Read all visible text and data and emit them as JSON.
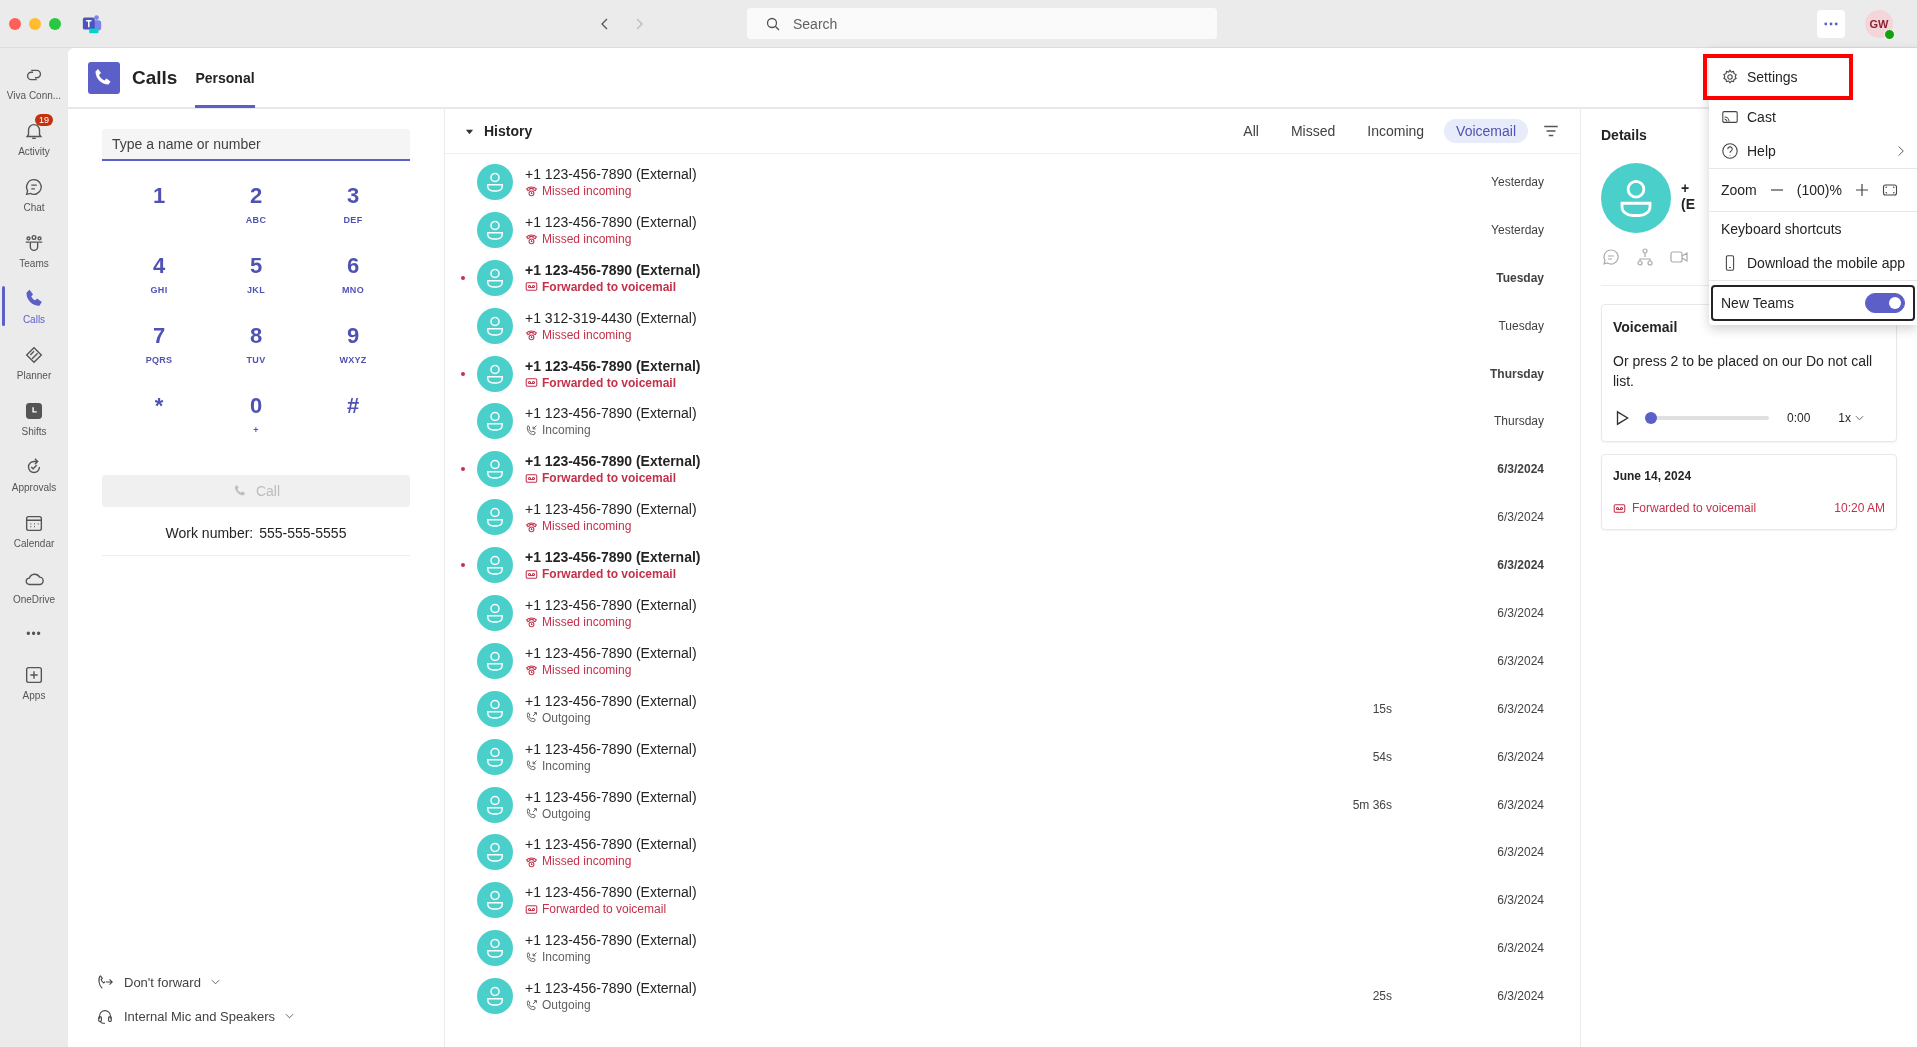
{
  "titlebar": {
    "search": {
      "placeholder": "Search"
    },
    "account": {
      "initials": "GW",
      "available": true
    }
  },
  "rail": [
    {
      "label": "Viva Conn...",
      "selected": false
    },
    {
      "label": "Activity",
      "selected": false,
      "badge": "19"
    },
    {
      "label": "Chat",
      "selected": false
    },
    {
      "label": "Teams",
      "selected": false
    },
    {
      "label": "Calls",
      "selected": true
    },
    {
      "label": "Planner",
      "selected": false
    },
    {
      "label": "Shifts",
      "selected": false
    },
    {
      "label": "Approvals",
      "selected": false
    },
    {
      "label": "Calendar",
      "selected": false
    },
    {
      "label": "OneDrive",
      "selected": false
    },
    {
      "label": "•••",
      "selected": false
    },
    {
      "label": "Apps",
      "selected": false
    }
  ],
  "header": {
    "title": "Calls",
    "tabs": [
      {
        "label": "Personal",
        "selected": true
      }
    ]
  },
  "dialer": {
    "placeholder": "Type a name or number",
    "keys": [
      {
        "digit": "1"
      },
      {
        "digit": "2",
        "letters": "ABC"
      },
      {
        "digit": "3",
        "letters": "DEF"
      },
      {
        "digit": "4",
        "letters": "GHI"
      },
      {
        "digit": "5",
        "letters": "JKL"
      },
      {
        "digit": "6",
        "letters": "MNO"
      },
      {
        "digit": "7",
        "letters": "PQRS"
      },
      {
        "digit": "8",
        "letters": "TUV"
      },
      {
        "digit": "9",
        "letters": "WXYZ"
      },
      {
        "digit": "*"
      },
      {
        "digit": "0",
        "letters": "+"
      },
      {
        "digit": "#"
      }
    ],
    "call_button": {
      "label": "Call",
      "disabled": true
    },
    "work_number_label": "Work number:",
    "work_number": "555-555-5555",
    "forwarding": "Don't forward",
    "device": "Internal Mic and Speakers"
  },
  "history": {
    "title": "History",
    "expanded": true,
    "filters": [
      {
        "label": "All",
        "selected": false
      },
      {
        "label": "Missed",
        "selected": false
      },
      {
        "label": "Incoming",
        "selected": false
      },
      {
        "label": "Voicemail",
        "selected": true
      }
    ],
    "rows": [
      {
        "name": "+1 123-456-7890 (External)",
        "kind": "missed",
        "status": "Missed incoming",
        "date": "Yesterday",
        "unread": false
      },
      {
        "name": "+1 123-456-7890 (External)",
        "kind": "missed",
        "status": "Missed incoming",
        "date": "Yesterday",
        "unread": false
      },
      {
        "name": "+1 123-456-7890 (External)",
        "kind": "voicemail",
        "status": "Forwarded to voicemail",
        "date": "Tuesday",
        "unread": true
      },
      {
        "name": "+1 312-319-4430 (External)",
        "kind": "missed",
        "status": "Missed incoming",
        "date": "Tuesday",
        "unread": false
      },
      {
        "name": "+1 123-456-7890 (External)",
        "kind": "voicemail",
        "status": "Forwarded to voicemail",
        "date": "Thursday",
        "unread": true
      },
      {
        "name": "+1 123-456-7890 (External)",
        "kind": "incoming",
        "status": "Incoming",
        "date": "Thursday",
        "unread": false
      },
      {
        "name": "+1 123-456-7890 (External)",
        "kind": "voicemail",
        "status": "Forwarded to voicemail",
        "date": "6/3/2024",
        "unread": true
      },
      {
        "name": "+1 123-456-7890 (External)",
        "kind": "missed",
        "status": "Missed incoming",
        "date": "6/3/2024",
        "unread": false
      },
      {
        "name": "+1 123-456-7890 (External)",
        "kind": "voicemail",
        "status": "Forwarded to voicemail",
        "date": "6/3/2024",
        "unread": true
      },
      {
        "name": "+1 123-456-7890 (External)",
        "kind": "missed",
        "status": "Missed incoming",
        "date": "6/3/2024",
        "unread": false
      },
      {
        "name": "+1 123-456-7890 (External)",
        "kind": "missed",
        "status": "Missed incoming",
        "date": "6/3/2024",
        "unread": false
      },
      {
        "name": "+1 123-456-7890 (External)",
        "kind": "outgoing",
        "status": "Outgoing",
        "duration": "15s",
        "date": "6/3/2024",
        "unread": false
      },
      {
        "name": "+1 123-456-7890 (External)",
        "kind": "incoming",
        "status": "Incoming",
        "duration": "54s",
        "date": "6/3/2024",
        "unread": false
      },
      {
        "name": "+1 123-456-7890 (External)",
        "kind": "outgoing",
        "status": "Outgoing",
        "duration": "5m 36s",
        "date": "6/3/2024",
        "unread": false
      },
      {
        "name": "+1 123-456-7890 (External)",
        "kind": "missed",
        "status": "Missed incoming",
        "date": "6/3/2024",
        "unread": false
      },
      {
        "name": "+1 123-456-7890 (External)",
        "kind": "voicemail",
        "status": "Forwarded to voicemail",
        "date": "6/3/2024",
        "unread": false
      },
      {
        "name": "+1 123-456-7890 (External)",
        "kind": "incoming",
        "status": "Incoming",
        "date": "6/3/2024",
        "unread": false
      },
      {
        "name": "+1 123-456-7890 (External)",
        "kind": "outgoing",
        "status": "Outgoing",
        "duration": "25s",
        "date": "6/3/2024",
        "unread": false
      }
    ]
  },
  "details": {
    "title": "Details",
    "name_lines": [
      "+",
      "(E"
    ],
    "voicemail": {
      "title": "Voicemail",
      "transcript": "Or press 2 to be placed on our Do not call list.",
      "level": 0,
      "time": "0:00",
      "speed": "1x"
    },
    "entry": {
      "date": "June 14, 2024",
      "status": "Forwarded to voicemail",
      "time": "10:20 AM"
    }
  },
  "menu": {
    "items": [
      {
        "kind": "item",
        "label": "Settings",
        "highlighted": true
      },
      {
        "kind": "item",
        "label": "Cast",
        "highlighted": false
      },
      {
        "kind": "submenu",
        "label": "Help",
        "highlighted": false
      },
      {
        "kind": "zoom",
        "label": "Zoom",
        "value": "(100)%",
        "highlighted": false
      },
      {
        "kind": "item",
        "label": "Keyboard shortcuts",
        "highlighted": false
      },
      {
        "kind": "item",
        "label": "Download the mobile app",
        "highlighted": false
      },
      {
        "kind": "toggle",
        "label": "New Teams",
        "on": true,
        "highlighted": false
      }
    ]
  }
}
